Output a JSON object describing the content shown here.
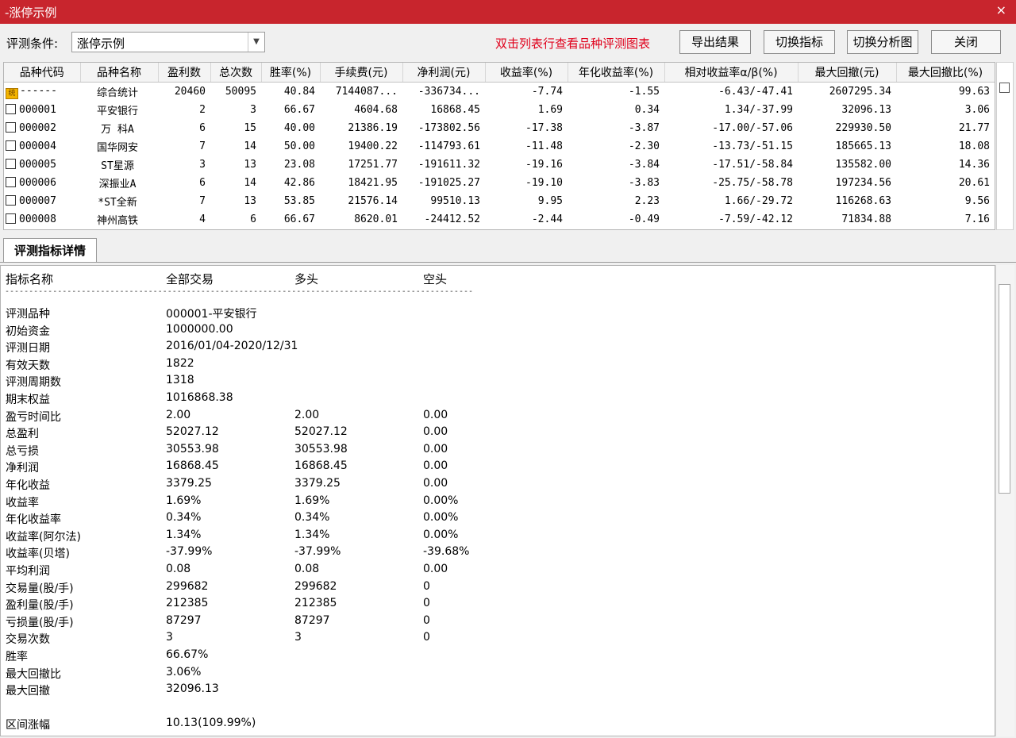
{
  "window": {
    "title": "-涨停示例",
    "close": "×"
  },
  "toolbar": {
    "condition_label": "评测条件:",
    "condition_value": "涨停示例",
    "hint": "双击列表行查看品种评测图表",
    "buttons": [
      "导出结果",
      "切换指标",
      "切换分析图",
      "关闭"
    ]
  },
  "grid": {
    "columns": [
      "品种代码",
      "品种名称",
      "盈利数",
      "总次数",
      "胜率(%)",
      "手续费(元)",
      "净利润(元)",
      "收益率(%)",
      "年化收益率(%)",
      "相对收益率α/β(%)",
      "最大回撤(元)",
      "最大回撤比(%)"
    ],
    "summary": {
      "icon": "统",
      "code": "------",
      "name": "综合统计",
      "win": "20460",
      "total": "50095",
      "rate": "40.84",
      "fee": "7144087...",
      "profit": "-336734...",
      "ret": "-7.74",
      "annual": "-1.55",
      "rel": "-6.43/-47.41",
      "maxdd": "2607295.34",
      "ddratio": "99.63"
    },
    "rows": [
      {
        "code": "000001",
        "name": "平安银行",
        "win": "2",
        "total": "3",
        "rate": "66.67",
        "fee": "4604.68",
        "profit": "16868.45",
        "ret": "1.69",
        "annual": "0.34",
        "rel": "1.34/-37.99",
        "maxdd": "32096.13",
        "ddratio": "3.06"
      },
      {
        "code": "000002",
        "name": "万 科A",
        "win": "6",
        "total": "15",
        "rate": "40.00",
        "fee": "21386.19",
        "profit": "-173802.56",
        "ret": "-17.38",
        "annual": "-3.87",
        "rel": "-17.00/-57.06",
        "maxdd": "229930.50",
        "ddratio": "21.77"
      },
      {
        "code": "000004",
        "name": "国华网安",
        "win": "7",
        "total": "14",
        "rate": "50.00",
        "fee": "19400.22",
        "profit": "-114793.61",
        "ret": "-11.48",
        "annual": "-2.30",
        "rel": "-13.73/-51.15",
        "maxdd": "185665.13",
        "ddratio": "18.08"
      },
      {
        "code": "000005",
        "name": "ST星源",
        "win": "3",
        "total": "13",
        "rate": "23.08",
        "fee": "17251.77",
        "profit": "-191611.32",
        "ret": "-19.16",
        "annual": "-3.84",
        "rel": "-17.51/-58.84",
        "maxdd": "135582.00",
        "ddratio": "14.36"
      },
      {
        "code": "000006",
        "name": "深振业A",
        "win": "6",
        "total": "14",
        "rate": "42.86",
        "fee": "18421.95",
        "profit": "-191025.27",
        "ret": "-19.10",
        "annual": "-3.83",
        "rel": "-25.75/-58.78",
        "maxdd": "197234.56",
        "ddratio": "20.61"
      },
      {
        "code": "000007",
        "name": "*ST全新",
        "win": "7",
        "total": "13",
        "rate": "53.85",
        "fee": "21576.14",
        "profit": "99510.13",
        "ret": "9.95",
        "annual": "2.23",
        "rel": "1.66/-29.72",
        "maxdd": "116268.63",
        "ddratio": "9.56"
      },
      {
        "code": "000008",
        "name": "神州高铁",
        "win": "4",
        "total": "6",
        "rate": "66.67",
        "fee": "8620.01",
        "profit": "-24412.52",
        "ret": "-2.44",
        "annual": "-0.49",
        "rel": "-7.59/-42.12",
        "maxdd": "71834.88",
        "ddratio": "7.16"
      }
    ]
  },
  "detail": {
    "tab": "评测指标详情",
    "headers": [
      "指标名称",
      "全部交易",
      "多头",
      "空头"
    ],
    "separator": "--------------------------------------------------------------------------------------------------",
    "rows": [
      [
        "评测品种",
        "000001-平安银行",
        "",
        ""
      ],
      [
        "初始资金",
        "1000000.00",
        "",
        ""
      ],
      [
        "评测日期",
        "2016/01/04-2020/12/31",
        "",
        ""
      ],
      [
        "有效天数",
        "1822",
        "",
        ""
      ],
      [
        "评测周期数",
        "1318",
        "",
        ""
      ],
      [
        "期末权益",
        "1016868.38",
        "",
        ""
      ],
      [
        "盈亏时间比",
        "2.00",
        "2.00",
        "0.00"
      ],
      [
        "总盈利",
        "52027.12",
        "52027.12",
        "0.00"
      ],
      [
        "总亏损",
        "30553.98",
        "30553.98",
        "0.00"
      ],
      [
        "净利润",
        "16868.45",
        "16868.45",
        "0.00"
      ],
      [
        "年化收益",
        "3379.25",
        "3379.25",
        "0.00"
      ],
      [
        "收益率",
        "1.69%",
        "1.69%",
        "0.00%"
      ],
      [
        "年化收益率",
        "0.34%",
        "0.34%",
        "0.00%"
      ],
      [
        "收益率(阿尔法)",
        "1.34%",
        "1.34%",
        "0.00%"
      ],
      [
        "收益率(贝塔)",
        "-37.99%",
        "-37.99%",
        "-39.68%"
      ],
      [
        "平均利润",
        "0.08",
        "0.08",
        "0.00"
      ],
      [
        "交易量(股/手)",
        "299682",
        "299682",
        "0"
      ],
      [
        "盈利量(股/手)",
        "212385",
        "212385",
        "0"
      ],
      [
        "亏损量(股/手)",
        "87297",
        "87297",
        "0"
      ],
      [
        "交易次数",
        "3",
        "3",
        "0"
      ],
      [
        "胜率",
        "66.67%",
        "",
        ""
      ],
      [
        "最大回撤比",
        "3.06%",
        "",
        ""
      ],
      [
        "最大回撤",
        "32096.13",
        "",
        ""
      ],
      [
        "",
        "",
        "",
        ""
      ],
      [
        "区间涨幅",
        "10.13(109.99%)",
        "",
        ""
      ]
    ]
  }
}
